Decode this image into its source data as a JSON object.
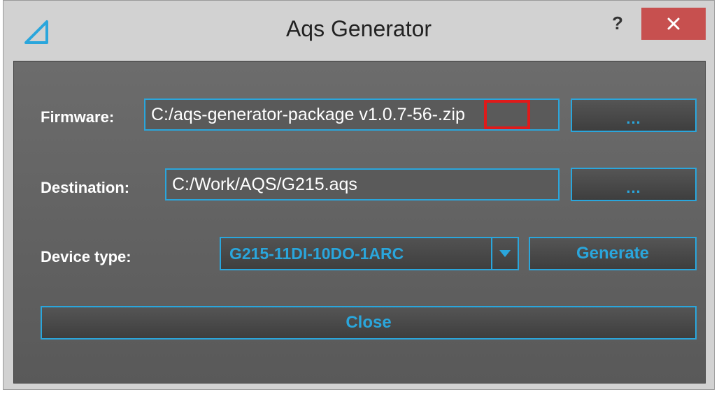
{
  "window": {
    "title": "Aqs Generator",
    "help_label": "?",
    "close_icon": "close-icon"
  },
  "form": {
    "firmware_label": "Firmware:",
    "firmware_value": "C:/aqs-generator-package v1.0.7-56-.zip",
    "firmware_browse_label": "...",
    "destination_label": "Destination:",
    "destination_value": "C:/Work/AQS/G215.aqs",
    "destination_browse_label": "...",
    "device_type_label": "Device type:",
    "device_type_value": "G215-11DI-10DO-1ARC",
    "generate_label": "Generate",
    "close_label": "Close"
  },
  "colors": {
    "accent": "#2aa6dc",
    "close_button": "#c7504f",
    "highlight": "#e01a1a"
  }
}
